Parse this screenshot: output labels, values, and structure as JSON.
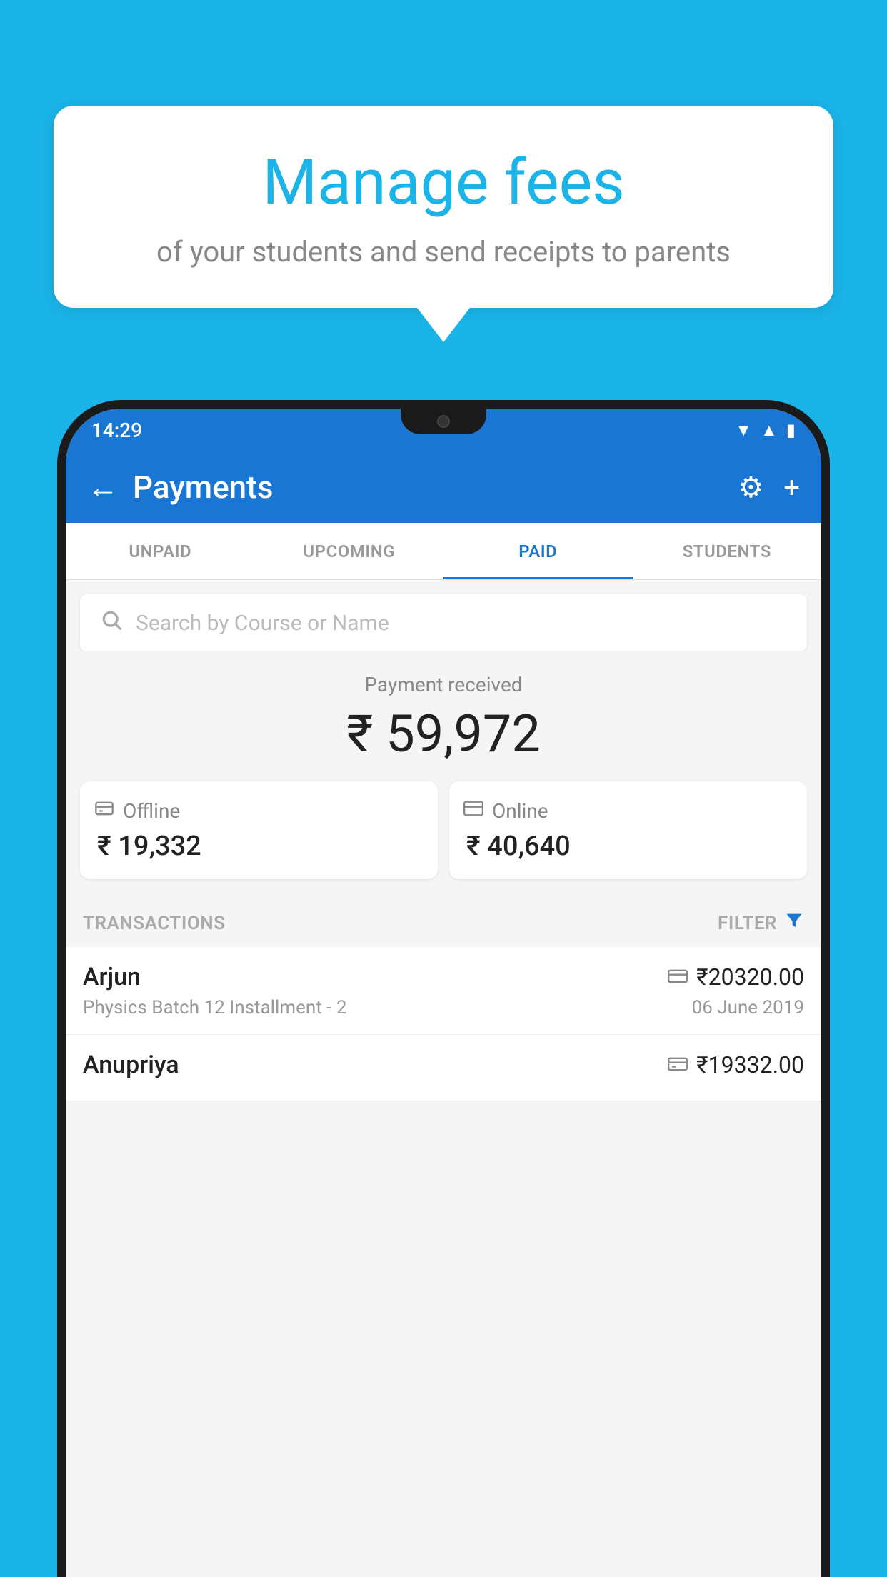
{
  "background_color": "#1ab4e8",
  "bubble": {
    "title": "Manage fees",
    "subtitle": "of your students and send receipts to parents"
  },
  "status_bar": {
    "time": "14:29",
    "wifi_icon": "▲",
    "signal_icon": "▲",
    "battery_icon": "▬"
  },
  "header": {
    "title": "Payments",
    "back_icon": "←",
    "settings_icon": "⚙",
    "add_icon": "+"
  },
  "tabs": [
    {
      "label": "UNPAID",
      "active": false
    },
    {
      "label": "UPCOMING",
      "active": false
    },
    {
      "label": "PAID",
      "active": true
    },
    {
      "label": "STUDENTS",
      "active": false
    }
  ],
  "search": {
    "placeholder": "Search by Course or Name",
    "icon": "🔍"
  },
  "payment": {
    "label": "Payment received",
    "amount": "₹ 59,972",
    "offline": {
      "label": "Offline",
      "amount": "₹ 19,332"
    },
    "online": {
      "label": "Online",
      "amount": "₹ 40,640"
    }
  },
  "transactions": {
    "label": "TRANSACTIONS",
    "filter_label": "FILTER",
    "rows": [
      {
        "name": "Arjun",
        "course": "Physics Batch 12 Installment - 2",
        "amount": "₹20320.00",
        "date": "06 June 2019",
        "payment_type": "card"
      },
      {
        "name": "Anupriya",
        "course": "",
        "amount": "₹19332.00",
        "date": "",
        "payment_type": "cash"
      }
    ]
  }
}
